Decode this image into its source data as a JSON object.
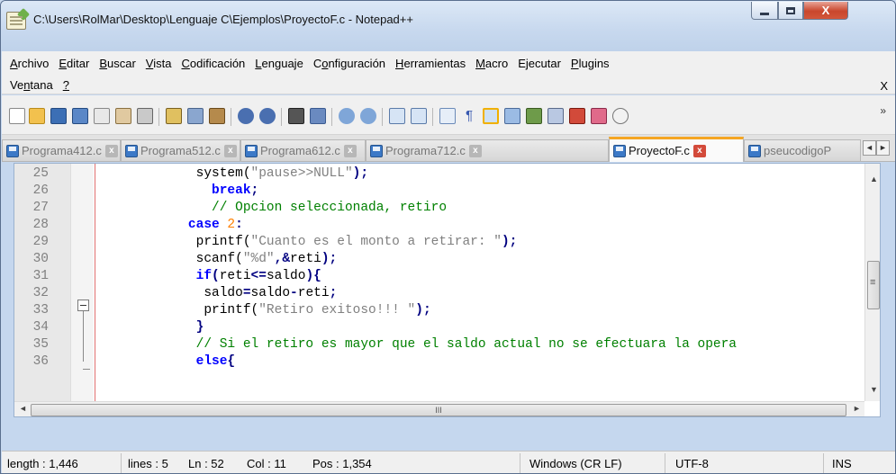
{
  "window": {
    "title": "C:\\Users\\RolMar\\Desktop\\Lenguaje C\\Ejemplos\\ProyectoF.c - Notepad++",
    "minimize_glyph": "",
    "close_glyph": "X"
  },
  "menu": {
    "row1": [
      {
        "key": "A",
        "rest": "rchivo"
      },
      {
        "key": "E",
        "rest": "ditar"
      },
      {
        "key": "B",
        "rest": "uscar"
      },
      {
        "key": "V",
        "rest": "ista"
      },
      {
        "key": "C",
        "rest": "odificación"
      },
      {
        "key": "L",
        "rest": "enguaje"
      },
      {
        "key": "",
        "pre": "C",
        "keymid": "o",
        "rest": "nfiguración"
      },
      {
        "key": "H",
        "rest": "erramientas"
      },
      {
        "key": "M",
        "rest": "acro"
      },
      {
        "key": "",
        "pre": "E",
        "keymid": "j",
        "rest": "ecutar"
      },
      {
        "key": "P",
        "rest": "lugins"
      }
    ],
    "row2": [
      {
        "pre": "Ve",
        "keymid": "n",
        "rest": "tana"
      },
      {
        "pre": "",
        "keymid": "?",
        "rest": ""
      }
    ],
    "doc_close": "X"
  },
  "toolbar": {
    "overflow": "»"
  },
  "tabs": [
    {
      "label": "Programa412.c",
      "active": false
    },
    {
      "label": "Programa512.c",
      "active": false
    },
    {
      "label": "Programa612.c",
      "active": false
    },
    {
      "label": "Programa712.c",
      "active": false
    },
    {
      "label": "ProyectoF.c",
      "active": true
    },
    {
      "label": "pseucodigoP",
      "active": false
    }
  ],
  "tab_close": "x",
  "tab_nav": {
    "left": "◄",
    "right": "►"
  },
  "editor": {
    "lines": [
      {
        "n": "25",
        "tokens": [
          [
            "fn",
            "        system("
          ],
          [
            "str",
            "\"pause>>NULL\""
          ],
          [
            "op",
            ");"
          ]
        ]
      },
      {
        "n": "26",
        "tokens": [
          [
            "kw",
            "          break"
          ],
          [
            "op",
            ";"
          ]
        ]
      },
      {
        "n": "27",
        "tokens": [
          [
            "cm",
            "          // Opcion seleccionada, retiro"
          ]
        ]
      },
      {
        "n": "28",
        "tokens": [
          [
            "kw",
            "       case "
          ],
          [
            "num",
            "2"
          ],
          [
            "op",
            ":"
          ]
        ]
      },
      {
        "n": "29",
        "tokens": [
          [
            "fn",
            "        printf("
          ],
          [
            "str",
            "\"Cuanto es el monto a retirar: \""
          ],
          [
            "op",
            ");"
          ]
        ]
      },
      {
        "n": "30",
        "tokens": [
          [
            "fn",
            "        scanf("
          ],
          [
            "str",
            "\"%d\""
          ],
          [
            "op",
            ",&"
          ],
          [
            "fn",
            "reti"
          ],
          [
            "op",
            ");"
          ]
        ]
      },
      {
        "n": "31",
        "tokens": [
          [
            "kw",
            "        if"
          ],
          [
            "op",
            "("
          ],
          [
            "fn",
            "reti"
          ],
          [
            "op",
            "<="
          ],
          [
            "fn",
            "saldo"
          ],
          [
            "op",
            ")"
          ],
          [
            "op",
            "{"
          ]
        ]
      },
      {
        "n": "32",
        "tokens": [
          [
            "fn",
            "         saldo"
          ],
          [
            "op",
            "="
          ],
          [
            "fn",
            "saldo"
          ],
          [
            "op",
            "-"
          ],
          [
            "fn",
            "reti"
          ],
          [
            "op",
            ";"
          ]
        ]
      },
      {
        "n": "33",
        "tokens": [
          [
            "fn",
            "         printf("
          ],
          [
            "str",
            "\"Retiro exitoso!!! \""
          ],
          [
            "op",
            ");"
          ]
        ]
      },
      {
        "n": "34",
        "tokens": [
          [
            "op",
            "        }"
          ]
        ]
      },
      {
        "n": "35",
        "tokens": [
          [
            "cm",
            "        // Si el retiro es mayor que el saldo actual no se efectuara la opera"
          ]
        ]
      },
      {
        "n": "36",
        "tokens": [
          [
            "kw",
            "        else"
          ],
          [
            "op",
            "{"
          ]
        ]
      }
    ]
  },
  "scroll": {
    "up": "▲",
    "down": "▼",
    "left": "◄",
    "right": "►",
    "grip": "III"
  },
  "status": {
    "length": "length : 1,446",
    "lines": "lines : 5",
    "ln": "Ln : 52",
    "col": "Col : 11",
    "pos": "Pos : 1,354",
    "eol": "Windows (CR LF)",
    "encoding": "UTF-8",
    "mode": "INS"
  }
}
